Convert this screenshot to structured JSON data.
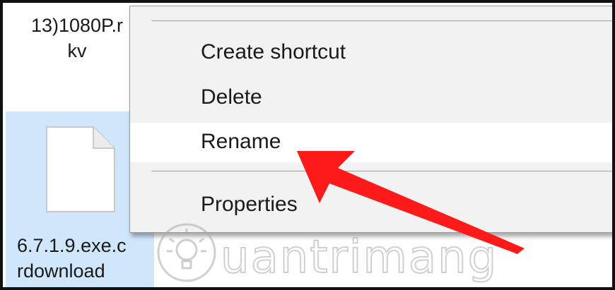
{
  "files": [
    {
      "name": "13)1080P.r\nkv",
      "selected": false
    },
    {
      "name": "6.7.1.9.exe.c\nrdownload",
      "selected": true,
      "icon": "blank-file-icon"
    }
  ],
  "context_menu": {
    "items": [
      {
        "label": "Create shortcut"
      },
      {
        "label": "Delete"
      },
      {
        "label": "Rename",
        "highlighted": true
      },
      {
        "label": "Properties"
      }
    ]
  },
  "annotation": {
    "type": "red-arrow",
    "points_to": "Rename",
    "color": "#ff1a1a"
  },
  "watermark": {
    "text": "uantrimang",
    "icon": "lightbulb-icon"
  },
  "colors": {
    "selection": "#cfe6fb",
    "menu_bg": "#f2f2f2",
    "menu_hover": "#ffffff"
  }
}
